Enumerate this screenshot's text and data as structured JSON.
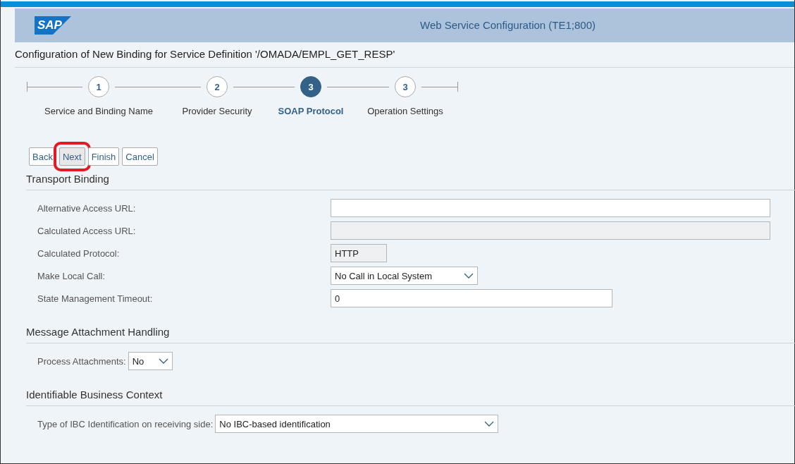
{
  "header": {
    "logo": "SAP",
    "title": "Web Service Configuration (TE1;800)"
  },
  "page_title": "Configuration of New Binding for Service Definition '/OMADA/EMPL_GET_RESP'",
  "steps": [
    {
      "number": "1",
      "label": "Service and Binding Name",
      "selected": false
    },
    {
      "number": "2",
      "label": "Provider Security",
      "selected": false
    },
    {
      "number": "3",
      "label": "SOAP Protocol",
      "selected": true
    },
    {
      "number": "3",
      "label": "Operation Settings",
      "selected": false
    }
  ],
  "buttons": [
    {
      "label": "Back",
      "highlighted": false
    },
    {
      "label": "Next",
      "highlighted": true
    },
    {
      "label": "Finish",
      "highlighted": false
    },
    {
      "label": "Cancel",
      "highlighted": false
    }
  ],
  "sections": [
    {
      "title": "Transport Binding",
      "fields": [
        {
          "label": "Alternative Access URL:",
          "kind": "text"
        },
        {
          "label": "Calculated Access URL:",
          "kind": "readonly"
        },
        {
          "label": "Calculated Protocol:",
          "kind": "readonly",
          "value": "HTTP"
        },
        {
          "label": "Make Local Call:",
          "kind": "select",
          "value": "No Call in Local System"
        },
        {
          "label": "State Management Timeout:",
          "kind": "text",
          "value": "0"
        }
      ]
    },
    {
      "title": "Message Attachment Handling",
      "fields": [
        {
          "label": "Process Attachments:",
          "kind": "select",
          "value": "No"
        }
      ]
    },
    {
      "title": "Identifiable Business Context",
      "fields": [
        {
          "label": "Type of IBC Identification on receiving side:",
          "kind": "select",
          "value": "No IBC-based identification"
        }
      ]
    }
  ]
}
